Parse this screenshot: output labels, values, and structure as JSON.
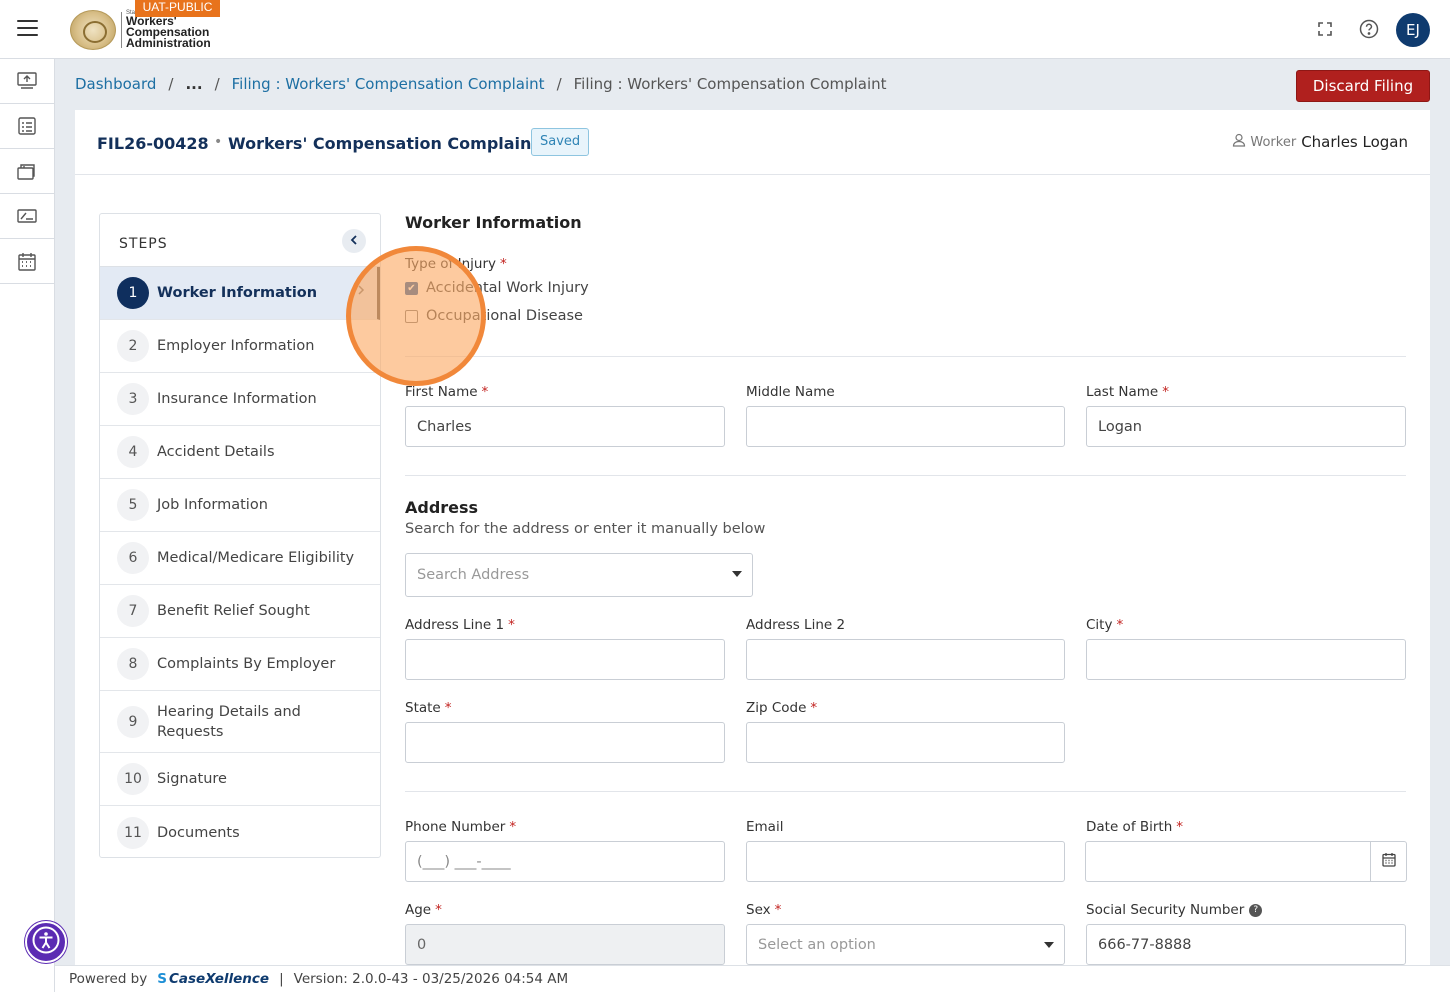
{
  "header": {
    "env_badge": "UAT-PUBLIC",
    "logo_small": "State",
    "logo_line1": "Workers'",
    "logo_line2": "Compensation",
    "logo_line3": "Administration",
    "avatar_initials": "EJ",
    "icons": [
      "hamburger-menu-icon",
      "fullscreen-icon",
      "help-icon"
    ]
  },
  "rail": {
    "icons": [
      "upload-screen-icon",
      "checklist-icon",
      "briefcase-icon",
      "scan-card-icon",
      "calendar-icon"
    ]
  },
  "breadcrumb": {
    "home": "Dashboard",
    "ellipsis": "...",
    "parent": "Filing : Workers' Compensation Complaint",
    "current": "Filing : Workers' Compensation Complaint",
    "separator": "/"
  },
  "actions": {
    "discard_label": "Discard Filing"
  },
  "filing": {
    "id": "FIL26-00428",
    "separator": "•",
    "title": "Workers' Compensation Complaint",
    "status": "Saved",
    "worker_label": "Worker",
    "worker_name": "Charles Logan"
  },
  "steps": {
    "title": "STEPS",
    "items": [
      {
        "num": "1",
        "label": "Worker Information"
      },
      {
        "num": "2",
        "label": "Employer Information"
      },
      {
        "num": "3",
        "label": "Insurance Information"
      },
      {
        "num": "4",
        "label": "Accident Details"
      },
      {
        "num": "5",
        "label": "Job Information"
      },
      {
        "num": "6",
        "label": "Medical/Medicare Eligibility"
      },
      {
        "num": "7",
        "label": "Benefit Relief Sought"
      },
      {
        "num": "8",
        "label": "Complaints By Employer"
      },
      {
        "num": "9",
        "label": "Hearing Details and Requests"
      },
      {
        "num": "10",
        "label": "Signature"
      },
      {
        "num": "11",
        "label": "Documents"
      }
    ]
  },
  "form": {
    "section_title": "Worker Information",
    "type_of_injury": {
      "label": "Type of Injury",
      "options": [
        {
          "label": "Accidental Work Injury",
          "checked": true
        },
        {
          "label": "Occupational Disease",
          "checked": false
        }
      ]
    },
    "first_name": {
      "label": "First Name",
      "value": "Charles"
    },
    "middle_name": {
      "label": "Middle Name",
      "value": ""
    },
    "last_name": {
      "label": "Last Name",
      "value": "Logan"
    },
    "address": {
      "title": "Address",
      "subtitle": "Search for the address or enter it manually below",
      "search_placeholder": "Search Address",
      "line1_label": "Address Line 1",
      "line2_label": "Address Line 2",
      "city_label": "City",
      "state_label": "State",
      "zip_label": "Zip Code"
    },
    "phone": {
      "label": "Phone Number",
      "mask": "(___) ___-____"
    },
    "email": {
      "label": "Email"
    },
    "dob": {
      "label": "Date of Birth"
    },
    "age": {
      "label": "Age",
      "value": "0"
    },
    "sex": {
      "label": "Sex",
      "placeholder": "Select an option"
    },
    "ssn": {
      "label": "Social Security Number",
      "value": "666-77-8888",
      "help": "?"
    },
    "required_mark": "*"
  },
  "footer": {
    "powered_by": "Powered by",
    "brand": "CaseXellence",
    "brand_mark": "S",
    "pipe": "|",
    "version": "Version: 2.0.0-43 - 03/25/2026 04:54 AM"
  },
  "colors": {
    "primary": "#0f2f5e",
    "link": "#1d6fa3",
    "danger": "#b0201e",
    "badge": "#e8731c",
    "highlight": "#f1883a"
  }
}
